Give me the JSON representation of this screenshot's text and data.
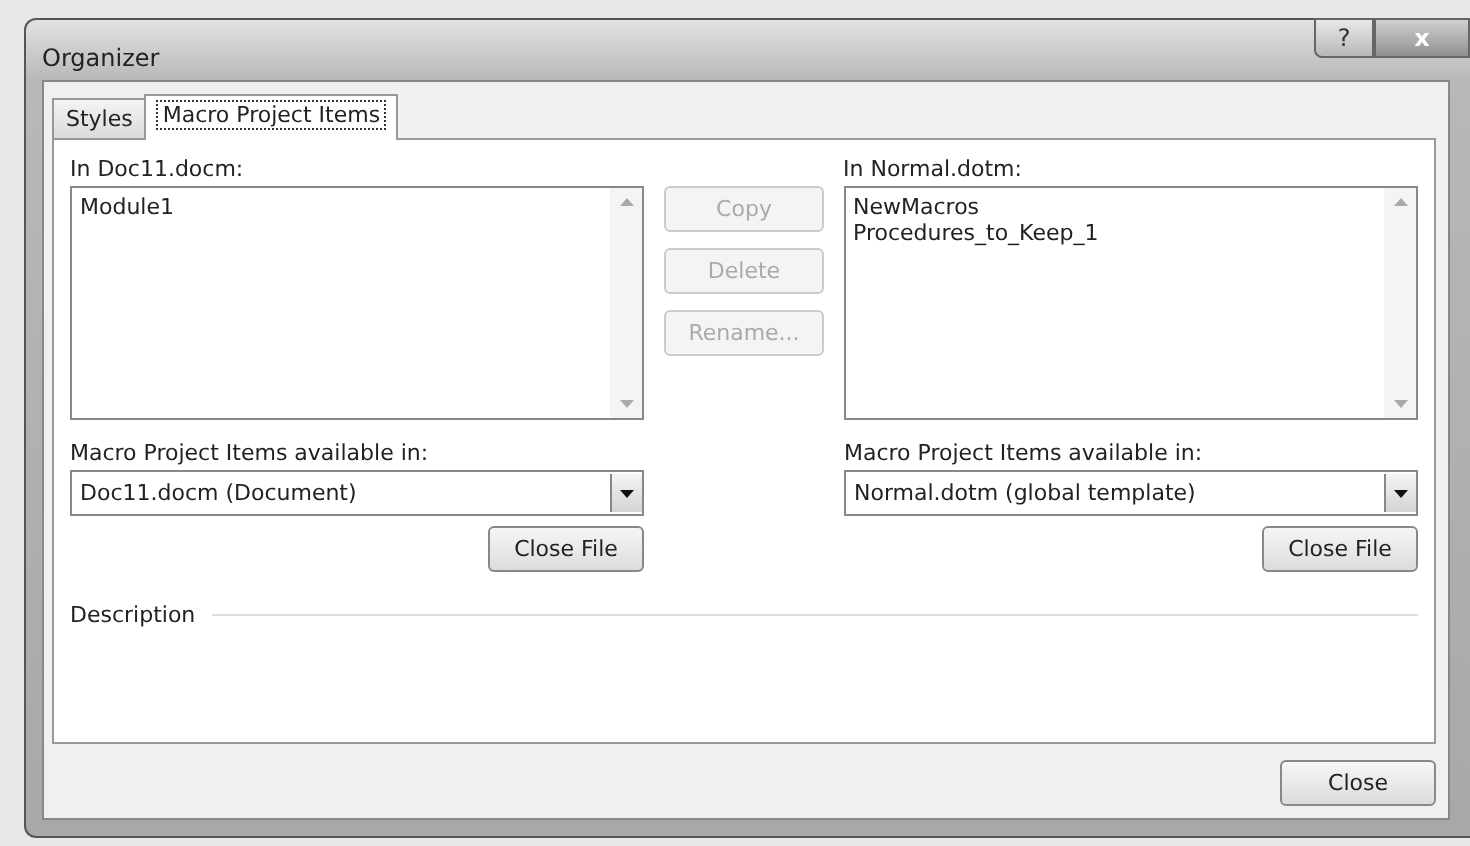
{
  "window": {
    "title": "Organizer",
    "controls": [
      "?",
      "x"
    ]
  },
  "tabs": [
    {
      "label": "Styles",
      "selected": false
    },
    {
      "label": "Macro Project Items",
      "selected": true
    }
  ],
  "panes": [
    {
      "label": "In Doc11.docm:",
      "items": [
        "Module1"
      ],
      "available_label": "Macro Project Items available in:",
      "available_value": "Doc11.docm (Document)",
      "close_file": "Close File"
    },
    {
      "label": "In Normal.dotm:",
      "items": [
        "NewMacros",
        "Procedures_to_Keep_1"
      ],
      "available_label": "Macro Project Items available in:",
      "available_value": "Normal.dotm (global template)",
      "close_file": "Close File"
    }
  ],
  "actions": [
    {
      "label": "Copy",
      "disabled": true
    },
    {
      "label": "Delete",
      "disabled": true
    },
    {
      "label": "Rename...",
      "disabled": true
    }
  ],
  "description": {
    "label": "Description"
  },
  "buttons": [
    "Close"
  ]
}
